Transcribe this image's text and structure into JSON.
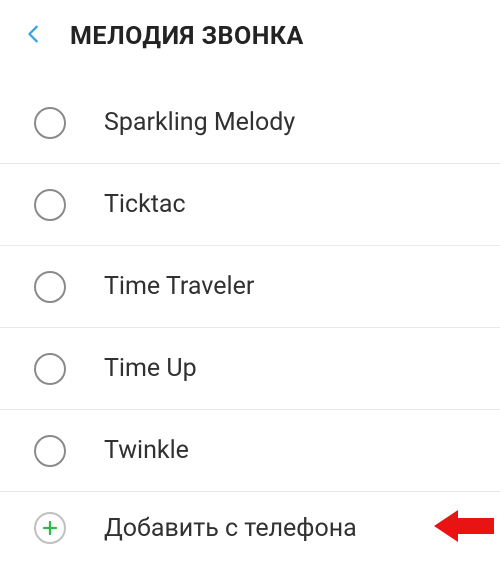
{
  "header": {
    "title": "МЕЛОДИЯ ЗВОНКА"
  },
  "ringtones": [
    {
      "label": "Sparkling Melody"
    },
    {
      "label": "Ticktac"
    },
    {
      "label": "Time Traveler"
    },
    {
      "label": "Time Up"
    },
    {
      "label": "Twinkle"
    }
  ],
  "add": {
    "label": "Добавить с телефона"
  }
}
